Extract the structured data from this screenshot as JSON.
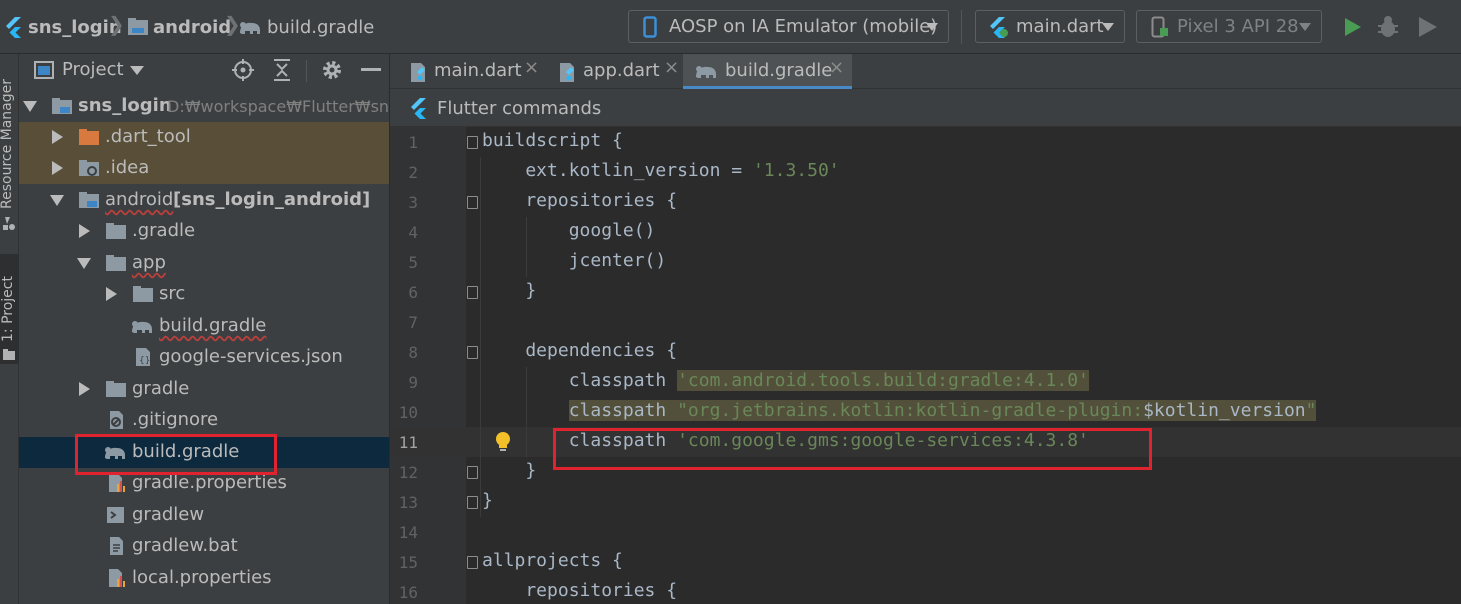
{
  "breadcrumb": {
    "items": [
      "sns_login",
      "android",
      "build.gradle"
    ]
  },
  "toolbar": {
    "device_selector": "AOSP on IA Emulator (mobile)",
    "run_config": "main.dart",
    "avd": "Pixel 3 API 28",
    "run_color": "#499c54"
  },
  "side_tabs": {
    "resource_manager": "Resource Manager",
    "project": "1: Project"
  },
  "project_panel": {
    "title": "Project",
    "tree": [
      {
        "label": "sns_login",
        "path": "D:₩workspace₩Flutter₩sns_",
        "depth": 0,
        "expanded": true,
        "icon": "module-folder-icon"
      },
      {
        "label": ".dart_tool",
        "depth": 1,
        "expanded": false,
        "icon": "excluded-folder-icon"
      },
      {
        "label": ".idea",
        "depth": 1,
        "expanded": false,
        "icon": "settings-folder-icon"
      },
      {
        "label": "android",
        "suffix": "[sns_login_android]",
        "depth": 1,
        "expanded": true,
        "icon": "module-folder-icon"
      },
      {
        "label": ".gradle",
        "depth": 2,
        "expanded": false,
        "icon": "folder-icon"
      },
      {
        "label": "app",
        "depth": 2,
        "expanded": true,
        "icon": "folder-icon"
      },
      {
        "label": "src",
        "depth": 3,
        "expanded": false,
        "icon": "folder-icon"
      },
      {
        "label": "build.gradle",
        "depth": 3,
        "icon": "gradle-elephant-icon"
      },
      {
        "label": "google-services.json",
        "depth": 3,
        "icon": "json-file-icon"
      },
      {
        "label": "gradle",
        "depth": 2,
        "expanded": false,
        "icon": "folder-icon"
      },
      {
        "label": ".gitignore",
        "depth": 2,
        "icon": "gitignore-file-icon"
      },
      {
        "label": "build.gradle",
        "depth": 2,
        "icon": "gradle-elephant-icon",
        "selected": true
      },
      {
        "label": "gradle.properties",
        "depth": 2,
        "icon": "properties-file-icon"
      },
      {
        "label": "gradlew",
        "depth": 2,
        "icon": "script-file-icon"
      },
      {
        "label": "gradlew.bat",
        "depth": 2,
        "icon": "text-file-icon"
      },
      {
        "label": "local.properties",
        "depth": 2,
        "icon": "properties-file-icon"
      }
    ]
  },
  "editor": {
    "tabs": [
      {
        "label": "main.dart",
        "icon": "dart-file-icon",
        "active": false
      },
      {
        "label": "app.dart",
        "icon": "dart-file-icon",
        "active": false
      },
      {
        "label": "build.gradle",
        "icon": "gradle-elephant-icon",
        "active": true
      }
    ],
    "flutter_commands": "Flutter commands",
    "current_line": 11,
    "lines": [
      {
        "n": "1",
        "text": "buildscript {"
      },
      {
        "n": "2",
        "text": "    ext.kotlin_version = ",
        "str": "'1.3.50'"
      },
      {
        "n": "3",
        "text": "    repositories {"
      },
      {
        "n": "4",
        "text": "        google()"
      },
      {
        "n": "5",
        "text": "        jcenter()"
      },
      {
        "n": "6",
        "text": "    }"
      },
      {
        "n": "7",
        "text": ""
      },
      {
        "n": "8",
        "text": "    dependencies {"
      },
      {
        "n": "9",
        "text": "        classpath ",
        "str": "'com.android.tools.build:gradle:4.1.0'"
      },
      {
        "n": "10",
        "text": "        classpath ",
        "str": "\"org.jetbrains.kotlin:kotlin-gradle-plugin:",
        "var": "$kotlin_version",
        "str2": "\""
      },
      {
        "n": "11",
        "text": "        classpath ",
        "str": "'com.google.gms:google-services:4.3.8'"
      },
      {
        "n": "12",
        "text": "    }"
      },
      {
        "n": "13",
        "text": "}"
      },
      {
        "n": "14",
        "text": ""
      },
      {
        "n": "15",
        "text": "allprojects {"
      },
      {
        "n": "16",
        "text": "    repositories {"
      }
    ]
  },
  "annotation_color": "#e0232e"
}
